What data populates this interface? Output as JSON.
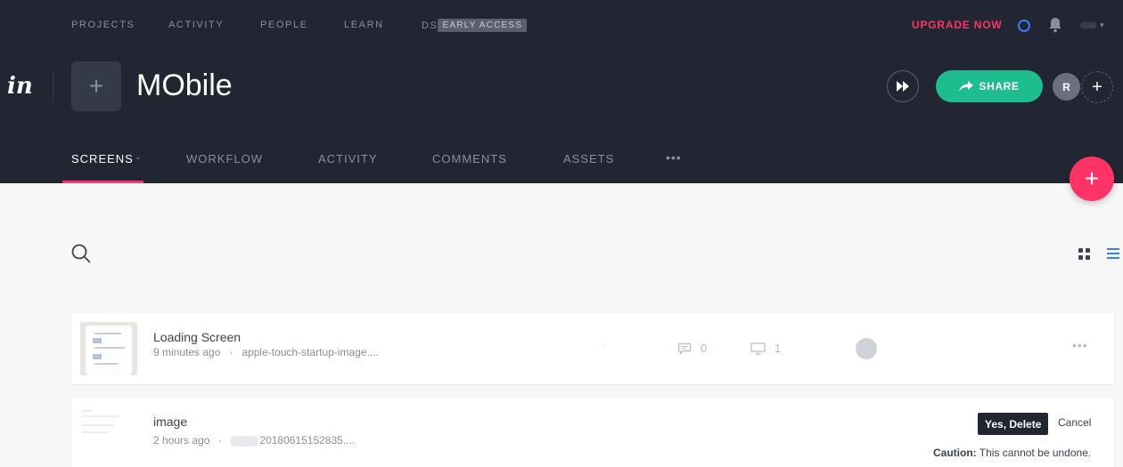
{
  "top_nav": {
    "projects": "PROJECTS",
    "activity": "ACTIVITY",
    "people": "PEOPLE",
    "learn": "LEARN",
    "ds": "DS",
    "early_access": "EARLY ACCESS",
    "upgrade": "UPGRADE NOW"
  },
  "project": {
    "logo": "in",
    "title": "MObile",
    "share_label": "SHARE",
    "avatar_initial": "R"
  },
  "tabs": {
    "screens": "SCREENS",
    "workflow": "WORKFLOW",
    "activity": "ACTIVITY",
    "comments": "COMMENTS",
    "assets": "ASSETS",
    "more": "•••"
  },
  "screens": [
    {
      "name": "Loading Screen",
      "time": "9 minutes ago",
      "file": "apple-touch-startup-image....",
      "comments": "0",
      "devices": "1"
    },
    {
      "name": "image",
      "time": "2 hours ago",
      "file": "20180615152835....",
      "confirm_label": "Yes, Delete",
      "cancel_label": "Cancel",
      "caution_label": "Caution:",
      "caution_text": "This cannot be undone."
    }
  ],
  "colors": {
    "header_bg": "#222633",
    "accent_pink": "#ff3366",
    "share_green": "#1ebd8e",
    "active_blue": "#3d7bf4"
  }
}
